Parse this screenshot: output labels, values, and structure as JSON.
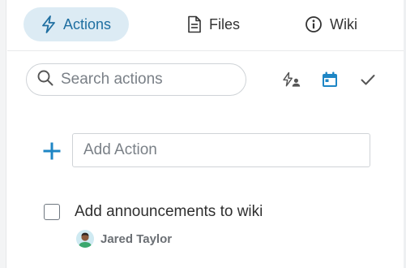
{
  "tabs": [
    {
      "label": "Actions",
      "icon": "lightning-icon",
      "active": true
    },
    {
      "label": "Files",
      "icon": "file-icon",
      "active": false
    },
    {
      "label": "Wiki",
      "icon": "info-icon",
      "active": false
    }
  ],
  "search": {
    "placeholder": "Search actions"
  },
  "toolbar": {
    "icons": [
      "assigned-to-me-icon",
      "calendar-icon",
      "checkmark-icon"
    ]
  },
  "add_action": {
    "placeholder": "Add Action"
  },
  "actions": [
    {
      "title": "Add announcements to wiki",
      "assignee": "Jared Taylor",
      "completed": false
    }
  ],
  "colors": {
    "accent": "#1f6fa1",
    "active_tab_bg": "#dcebf4",
    "plus": "#1e86c5",
    "calendar": "#1e86c5"
  }
}
